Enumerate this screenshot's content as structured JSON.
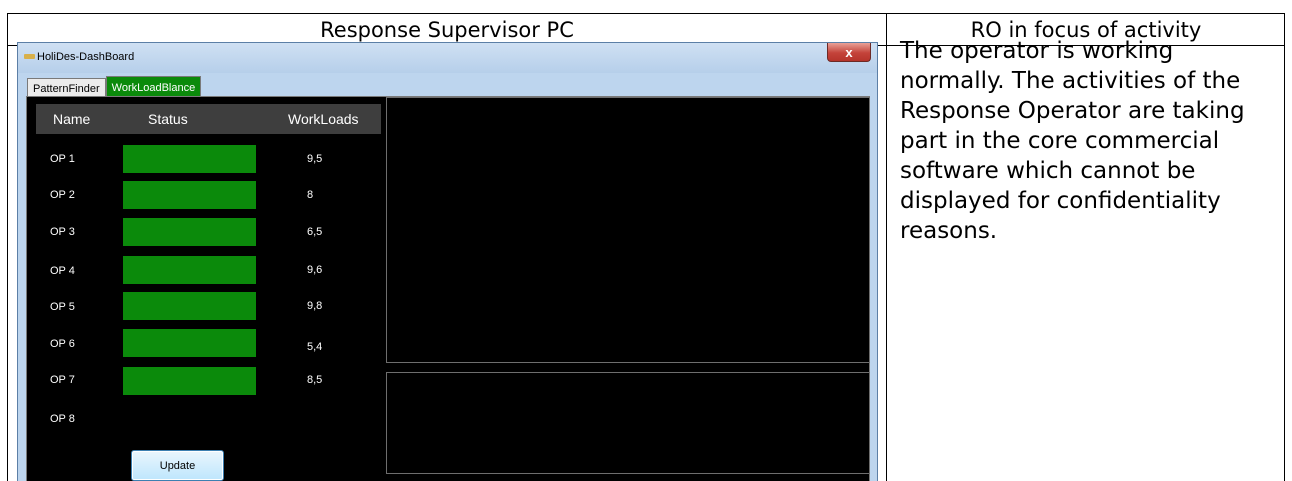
{
  "table": {
    "col_left_header": "Response Supervisor PC",
    "col_right_header": "RO in focus of activity",
    "description": "The operator is working normally. The activities of the Response Operator are taking part in the core commercial software which cannot be displayed for confidentiality reasons."
  },
  "window": {
    "title": "HoliDes-DashBoard",
    "close_label": "x",
    "tabs": [
      "PatternFinder",
      "WorkLoadBlance"
    ],
    "active_tab": "WorkLoadBlance"
  },
  "grid": {
    "headers": {
      "name": "Name",
      "status": "Status",
      "workloads": "WorkLoads"
    },
    "rows": [
      {
        "name": "OP 1",
        "workload": "9,5",
        "status_color": "#0b8a0b"
      },
      {
        "name": "OP 2",
        "workload": "8",
        "status_color": "#0b8a0b"
      },
      {
        "name": "OP 3",
        "workload": "6,5",
        "status_color": "#0b8a0b"
      },
      {
        "name": "OP 4",
        "workload": "9,6",
        "status_color": "#0b8a0b"
      },
      {
        "name": "OP 5",
        "workload": "9,8",
        "status_color": "#0b8a0b"
      },
      {
        "name": "OP 6",
        "workload": "5,4",
        "status_color": "#0b8a0b"
      },
      {
        "name": "OP 7",
        "workload": "8,5",
        "status_color": "#0b8a0b"
      },
      {
        "name": "OP 8",
        "workload": "",
        "status_color": ""
      }
    ],
    "update_label": "Update"
  }
}
